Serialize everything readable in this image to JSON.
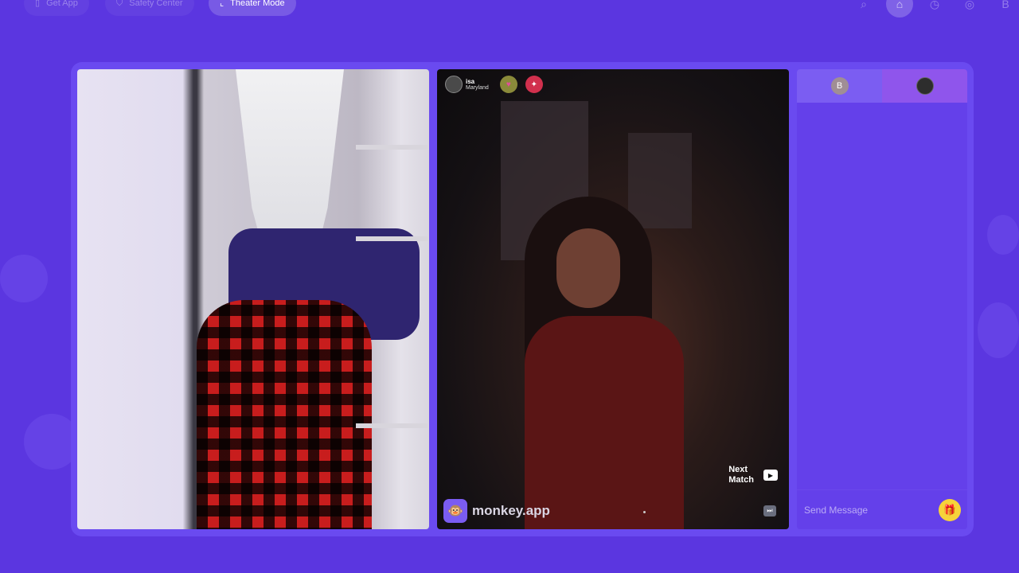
{
  "topbar": {
    "get_app": "Get App",
    "safety_center": "Safety Center",
    "theater_mode": "Theater Mode"
  },
  "peer": {
    "name": "isa",
    "location": "Maryland"
  },
  "video": {
    "next_match_line1": "Next",
    "next_match_line2": "Match",
    "brand": "monkey.app"
  },
  "chat": {
    "my_initial": "B",
    "placeholder": "Send Message"
  },
  "account": {
    "initial": "B"
  },
  "colors": {
    "background": "#5b36e0",
    "frame": "#6a4af0",
    "gift": "#f6d33a"
  }
}
